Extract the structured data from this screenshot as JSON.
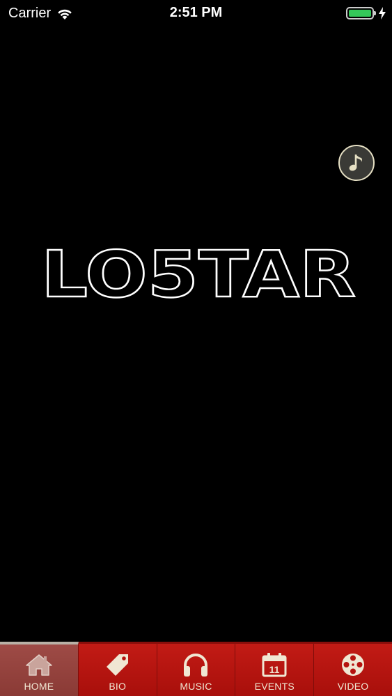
{
  "status_bar": {
    "carrier": "Carrier",
    "time": "2:51 PM",
    "battery_color": "#34c759"
  },
  "music_button": {
    "icon": "music-note-icon"
  },
  "logo": {
    "text": "LO5TAR"
  },
  "tabs": [
    {
      "label": "HOME",
      "icon": "home-icon",
      "active": true
    },
    {
      "label": "BIO",
      "icon": "tag-icon",
      "active": false
    },
    {
      "label": "MUSIC",
      "icon": "headphones-icon",
      "active": false
    },
    {
      "label": "EVENTS",
      "icon": "calendar-icon",
      "active": false,
      "badge": "11"
    },
    {
      "label": "VIDEO",
      "icon": "film-reel-icon",
      "active": false
    }
  ],
  "colors": {
    "tab_bar": "#b5130f",
    "tab_text": "#f0e7d3",
    "icon_fill": "#f0e7d3"
  }
}
